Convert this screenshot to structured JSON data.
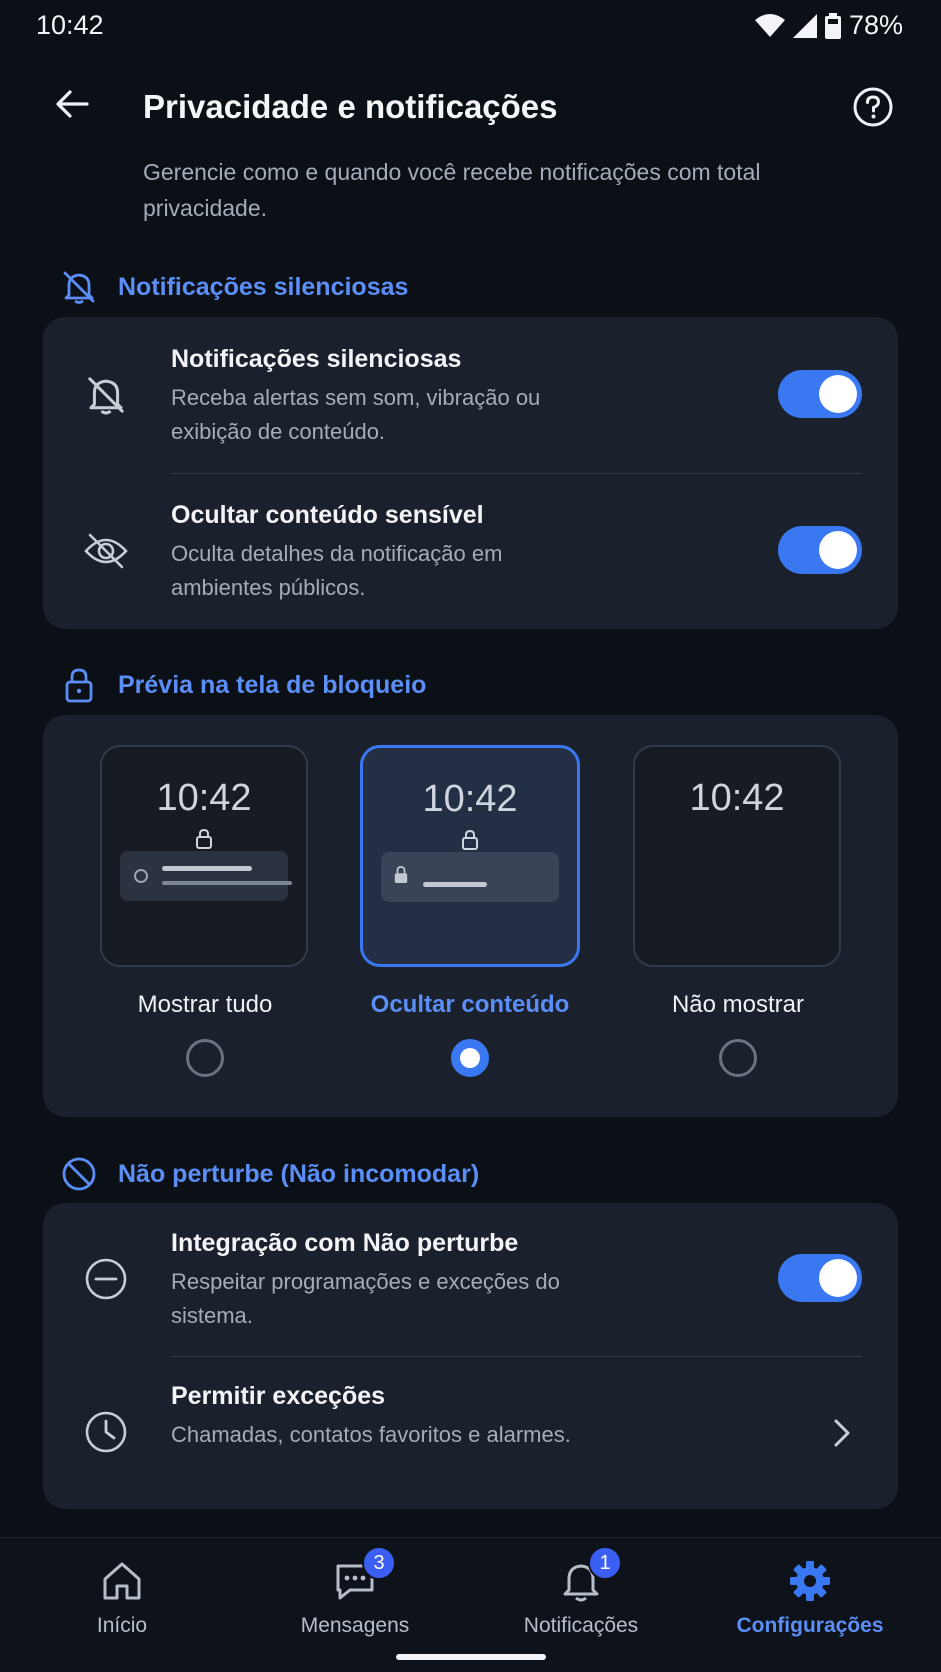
{
  "status_bar": {
    "time": "10:42",
    "battery": "78%"
  },
  "header": {
    "title": "Privacidade e notificações",
    "subtitle": "Gerencie como e quando você recebe notificações com total privacidade."
  },
  "sections": {
    "silent": {
      "heading": "Notificações silenciosas",
      "rows": [
        {
          "title": "Notificações silenciosas",
          "desc": "Receba alertas sem som, vibração ou exibição de conteúdo.",
          "enabled": true
        },
        {
          "title": "Ocultar conteúdo sensível",
          "desc": "Oculta detalhes da notificação em ambientes públicos.",
          "enabled": true
        }
      ]
    },
    "lock_preview": {
      "heading": "Prévia na tela de bloqueio",
      "options": [
        {
          "label": "Mostrar tudo",
          "time": "10:42",
          "selected": false
        },
        {
          "label": "Ocultar conteúdo",
          "time": "10:42",
          "selected": true
        },
        {
          "label": "Não mostrar",
          "time": "10:42",
          "selected": false
        }
      ]
    },
    "dnd": {
      "heading": "Não perturbe (Não incomodar)",
      "rows": [
        {
          "title": "Integração com Não perturbe",
          "desc": "Respeitar programações e exceções do sistema.",
          "enabled": true
        },
        {
          "title": "Permitir exceções",
          "desc": "Chamadas, contatos favoritos e alarmes."
        }
      ]
    }
  },
  "bottom_nav": {
    "items": [
      {
        "label": "Início",
        "icon": "home-icon",
        "badge": null,
        "active": false
      },
      {
        "label": "Mensagens",
        "icon": "chat-icon",
        "badge": "3",
        "active": false
      },
      {
        "label": "Notificações",
        "icon": "bell-icon",
        "badge": "1",
        "active": false
      },
      {
        "label": "Configurações",
        "icon": "gear-icon",
        "badge": null,
        "active": true
      }
    ]
  },
  "colors": {
    "accent": "#3a78f2",
    "background": "#0b0f16",
    "card": "#1b212c"
  }
}
